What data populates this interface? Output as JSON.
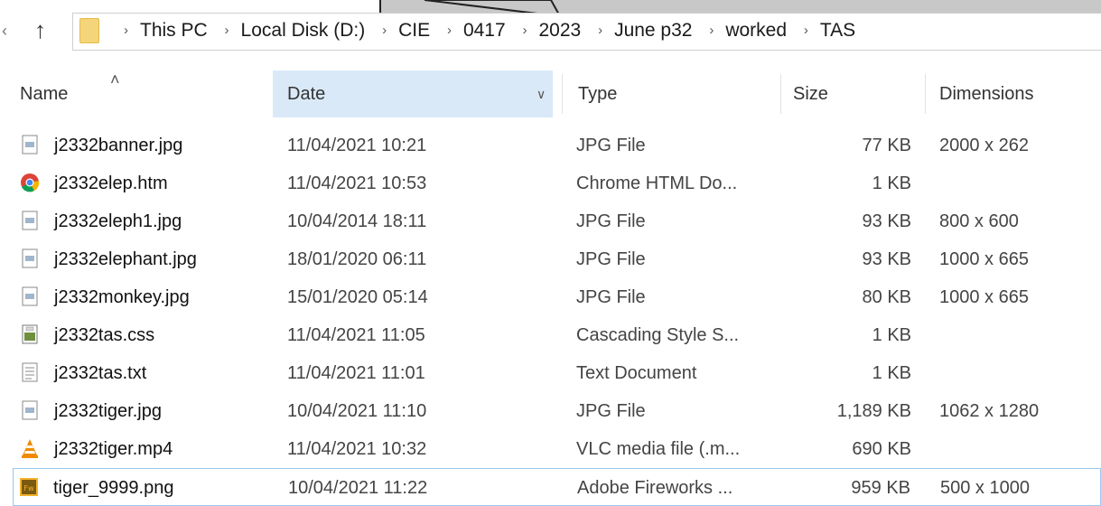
{
  "breadcrumb": [
    "This PC",
    "Local Disk (D:)",
    "CIE",
    "0417",
    "2023",
    "June p32",
    "worked",
    "TAS"
  ],
  "columns": {
    "name": "Name",
    "date": "Date",
    "type": "Type",
    "size": "Size",
    "dimensions": "Dimensions"
  },
  "files": [
    {
      "name": "j2332banner.jpg",
      "date": "11/04/2021 10:21",
      "type": "JPG File",
      "size": "77 KB",
      "dims": "2000 x 262",
      "icon": "image-file-icon"
    },
    {
      "name": "j2332elep.htm",
      "date": "11/04/2021 10:53",
      "type": "Chrome HTML Do...",
      "size": "1 KB",
      "dims": "",
      "icon": "chrome-icon"
    },
    {
      "name": "j2332eleph1.jpg",
      "date": "10/04/2014 18:11",
      "type": "JPG File",
      "size": "93 KB",
      "dims": "800 x 600",
      "icon": "image-file-icon"
    },
    {
      "name": "j2332elephant.jpg",
      "date": "18/01/2020 06:11",
      "type": "JPG File",
      "size": "93 KB",
      "dims": "1000 x 665",
      "icon": "image-file-icon"
    },
    {
      "name": "j2332monkey.jpg",
      "date": "15/01/2020 05:14",
      "type": "JPG File",
      "size": "80 KB",
      "dims": "1000 x 665",
      "icon": "image-file-icon"
    },
    {
      "name": "j2332tas.css",
      "date": "11/04/2021 11:05",
      "type": "Cascading Style S...",
      "size": "1 KB",
      "dims": "",
      "icon": "css-file-icon"
    },
    {
      "name": "j2332tas.txt",
      "date": "11/04/2021 11:01",
      "type": "Text Document",
      "size": "1 KB",
      "dims": "",
      "icon": "text-file-icon"
    },
    {
      "name": "j2332tiger.jpg",
      "date": "10/04/2021 11:10",
      "type": "JPG File",
      "size": "1,189 KB",
      "dims": "1062 x 1280",
      "icon": "image-file-icon"
    },
    {
      "name": "j2332tiger.mp4",
      "date": "11/04/2021 10:32",
      "type": "VLC media file (.m...",
      "size": "690 KB",
      "dims": "",
      "icon": "vlc-icon"
    },
    {
      "name": "tiger_9999.png",
      "date": "10/04/2021 11:22",
      "type": "Adobe Fireworks ...",
      "size": "959 KB",
      "dims": "500 x 1000",
      "icon": "fireworks-icon",
      "selected": true
    }
  ]
}
